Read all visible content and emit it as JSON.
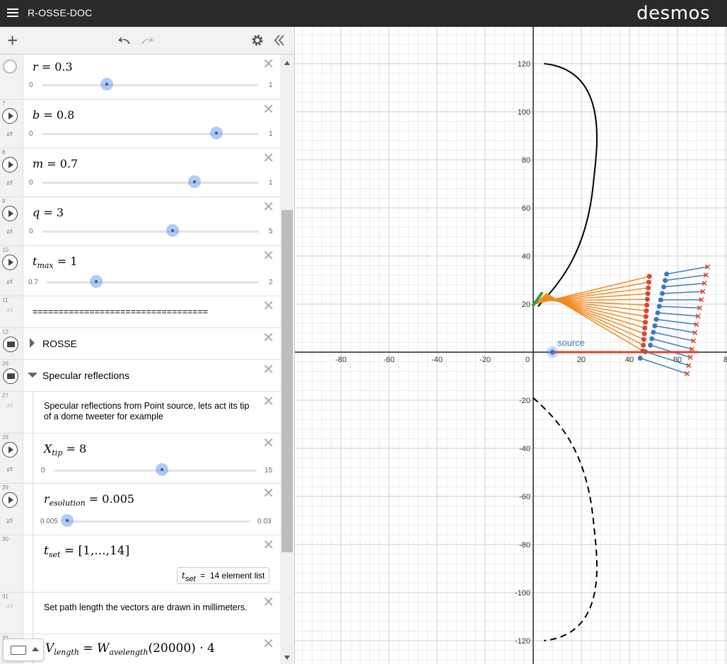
{
  "app": {
    "title": "R-OSSE-DOC",
    "logo": "desmos"
  },
  "expressions": [
    {
      "index": "6",
      "name": "r",
      "value": "0.3",
      "min": "0",
      "max": "1",
      "frac": 0.3
    },
    {
      "index": "7",
      "name": "b",
      "value": "0.8",
      "min": "0",
      "max": "1",
      "frac": 0.8
    },
    {
      "index": "8",
      "name": "m",
      "value": "0.7",
      "min": "0",
      "max": "1",
      "frac": 0.7
    },
    {
      "index": "9",
      "name": "q",
      "value": "3",
      "min": "0",
      "max": "5",
      "frac": 0.6
    },
    {
      "index": "10",
      "name": "t",
      "sub": "max",
      "value": "1",
      "min": "0.7",
      "max": "2",
      "frac": 0.23
    }
  ],
  "divider": {
    "index": "11",
    "text": "=================================="
  },
  "folders": [
    {
      "index": "12",
      "label": "ROSSE"
    },
    {
      "index": "26",
      "label": "Specular reflections"
    }
  ],
  "note1": {
    "index": "27",
    "text": "Specular reflections from Point source, lets act its tip of a dome tweeter for example"
  },
  "xtip": {
    "index": "28",
    "name": "X",
    "sub": "tip",
    "value": "8",
    "min": "0",
    "max": "15",
    "frac": 0.533
  },
  "resolution": {
    "index": "29",
    "name": "r",
    "sub": "esolution",
    "value": "0.005",
    "min": "0.005",
    "max": "0.03",
    "frac": 0.0
  },
  "tset": {
    "index": "30",
    "name": "t",
    "sub": "set",
    "expr": "[1,...,14]",
    "result_sub": "set",
    "result": "14 element list"
  },
  "note2": {
    "index": "31",
    "text": "Set path length the vectors are drawn in millimeters."
  },
  "vlength": {
    "index": "32",
    "lhs_sub": "length",
    "rhs": "W",
    "rhs_sub": "avelength",
    "arg": "(20000)",
    "tail": "· 4"
  },
  "graph": {
    "x_ticks": [
      "-80",
      "-60",
      "-40",
      "-20",
      "0",
      "20",
      "40",
      "60",
      "8"
    ],
    "y_ticks": [
      "120",
      "100",
      "80",
      "60",
      "40",
      "20",
      "-20",
      "-40",
      "-60",
      "-80",
      "-100",
      "-120"
    ],
    "source_label": "source",
    "colors": {
      "orange": "#f28b20",
      "red": "#d9462f",
      "blue": "#3b7bbf",
      "green": "#2e9e43",
      "black": "#000000"
    }
  }
}
